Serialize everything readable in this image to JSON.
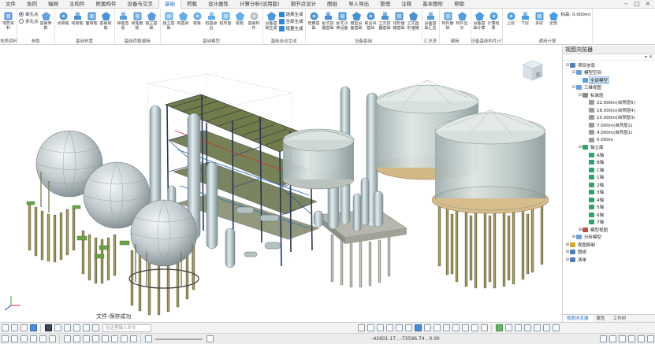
{
  "menu": {
    "tabs": [
      "文件",
      "协同",
      "轴网",
      "主构件",
      "附属构件",
      "设备与交叉",
      "基础",
      "荷载",
      "设计属性",
      "计算分析(试用版)",
      "钢节点设计",
      "图纸",
      "导入导出",
      "管理",
      "注释",
      "基本图形",
      "帮助"
    ],
    "active_index": 6
  },
  "ribbon": {
    "groups": [
      {
        "label": "地质资料",
        "buttons": [
          {
            "label": "地质资料",
            "icon": "geology-icon",
            "color": "#3a7bd5"
          }
        ]
      },
      {
        "label": "参数",
        "small": [
          {
            "label": "单孔点",
            "type": "radio",
            "on": true
          },
          {
            "label": "多孔点",
            "type": "radio",
            "on": false
          }
        ],
        "buttons": [
          {
            "label": "基础参数",
            "icon": "params-icon",
            "color": "#4a90d9"
          }
        ]
      },
      {
        "label": "基础布置",
        "buttons": [
          {
            "label": "点荷载",
            "icon": "point-load-icon",
            "color": "#2f80c9"
          },
          {
            "label": "线荷载",
            "icon": "line-load-icon",
            "color": "#2f80c9"
          },
          {
            "label": "面荷载",
            "icon": "area-load-icon",
            "color": "#2f80c9"
          },
          {
            "label": "基础荷载",
            "icon": "foundation-load-icon",
            "color": "#2f80c9"
          }
        ]
      },
      {
        "label": "基础荷载编辑",
        "buttons": [
          {
            "label": "荷载查看",
            "icon": "load-view-icon",
            "color": "#3d8ad6"
          },
          {
            "label": "荷载删除",
            "icon": "load-delete-icon",
            "color": "#3d8ad6"
          },
          {
            "label": "独立基础",
            "icon": "isolated-footing-icon",
            "color": "#3d8ad6"
          }
        ]
      },
      {
        "label": "基础模型",
        "buttons": [
          {
            "label": "独立基础",
            "icon": "isolated-footing-icon",
            "color": "#4aa0e0"
          },
          {
            "label": "地基梁",
            "icon": "grade-beam-icon",
            "color": "#4aa0e0"
          },
          {
            "label": "筏板",
            "icon": "raft-icon",
            "color": "#4aa0e0"
          },
          {
            "label": "桩基承台",
            "icon": "pile-cap-icon",
            "color": "#4aa0e0"
          },
          {
            "label": "桩布置",
            "icon": "pile-icon",
            "color": "#4aa0e0"
          },
          {
            "label": "桩帽",
            "icon": "pile-hat-icon",
            "color": "#4aa0e0"
          },
          {
            "label": "基础构件",
            "icon": "member-icon",
            "color": "#aab4bf"
          }
        ]
      },
      {
        "label": "基础自动生成",
        "buttons": [
          {
            "label": "设备基础生成参数",
            "icon": "gen-params-icon",
            "color": "#2f86d2"
          }
        ],
        "small": [
          {
            "label": "选择生成",
            "type": "icon",
            "color": "#2f86d2"
          },
          {
            "label": "全部生成",
            "type": "icon",
            "color": "#2f86d2"
          },
          {
            "label": "增量生成",
            "type": "icon",
            "color": "#2f86d2"
          }
        ]
      },
      {
        "label": "设备基础",
        "buttons": [
          {
            "label": "管廊基础",
            "icon": "pipe-rack-icon",
            "color": "#2d7cc8"
          },
          {
            "label": "卧式容器基础",
            "icon": "horizontal-vessel-icon",
            "color": "#2d7cc8"
          },
          {
            "label": "卧式冷换设备基础",
            "icon": "exchanger-icon",
            "color": "#2d7cc8"
          },
          {
            "label": "模型设备基础",
            "icon": "model-equip-icon",
            "color": "#2d7cc8"
          },
          {
            "label": "联合块基础",
            "icon": "combined-block-icon",
            "color": "#2d7cc8"
          },
          {
            "label": "立式容器基础",
            "icon": "vertical-vessel-icon",
            "color": "#2d7cc8"
          },
          {
            "label": "球形储罐基础",
            "icon": "sphere-tank-icon",
            "color": "#2d7cc8"
          },
          {
            "label": "立式圆形储罐基础",
            "icon": "cylinder-tank-icon",
            "color": "#2d7cc8"
          }
        ]
      },
      {
        "label": "汇总表",
        "buttons": [
          {
            "label": "设备基础汇总表",
            "icon": "summary-table-icon",
            "color": "#3b8bd4"
          }
        ]
      },
      {
        "label": "编辑",
        "buttons": [
          {
            "label": "构件删除",
            "icon": "member-delete-icon",
            "color": "#3b8bd4"
          },
          {
            "label": "构件显示",
            "icon": "member-show-icon",
            "color": "#3b8bd4"
          }
        ]
      },
      {
        "label": "设备基础构件计算",
        "buttons": [
          {
            "label": "设备基础计算",
            "icon": "calc-run-icon",
            "color": "#2e8bd8"
          },
          {
            "label": "计算结果",
            "icon": "calc-result-icon",
            "color": "#2e8bd8"
          }
        ]
      },
      {
        "label": "通用计算",
        "buttons": [
          {
            "label": "上层",
            "icon": "floor-up-icon",
            "color": "#2e8bd8"
          },
          {
            "label": "下层",
            "icon": "floor-down-icon",
            "color": "#2e8bd8"
          },
          {
            "label": "多层",
            "icon": "multi-floor-icon",
            "color": "#2e8bd8"
          },
          {
            "label": "全部",
            "icon": "all-floors-icon",
            "color": "#2e8bd8"
          }
        ],
        "small": [
          {
            "label": "标高: 0.000m)",
            "type": "text"
          }
        ]
      }
    ]
  },
  "viewport": {
    "status_message": "文件-保存成功",
    "nav_cube_label": "前"
  },
  "browser": {
    "title": "视图浏览器",
    "tree": [
      {
        "depth": 0,
        "label": "项目信息",
        "expanded": true,
        "icon_color": "#4d7fb8"
      },
      {
        "depth": 1,
        "label": "模型空间",
        "expanded": true,
        "icon_color": "#6a9fd8"
      },
      {
        "depth": 2,
        "label": "全部模型",
        "icon_color": "#5aa0e0",
        "selected": true
      },
      {
        "depth": 1,
        "label": "三维视图",
        "expanded": true,
        "icon_color": "#6a9fd8"
      },
      {
        "depth": 2,
        "label": "标准层",
        "expanded": true,
        "icon_color": "#888888"
      },
      {
        "depth": 3,
        "label": "22.000m(自然层5)",
        "icon_color": "#999999"
      },
      {
        "depth": 3,
        "label": "18.000m(自然层4)",
        "icon_color": "#999999"
      },
      {
        "depth": 3,
        "label": "10.000m(自然层3)",
        "icon_color": "#999999"
      },
      {
        "depth": 3,
        "label": "7.000m(自然层2)",
        "icon_color": "#999999"
      },
      {
        "depth": 3,
        "label": "4.000m(自然层1)",
        "icon_color": "#999999"
      },
      {
        "depth": 3,
        "label": "0.000m",
        "icon_color": "#999999"
      },
      {
        "depth": 2,
        "label": "轴立面",
        "expanded": true,
        "icon_color": "#3a9e6a"
      },
      {
        "depth": 3,
        "label": "A轴",
        "icon_color": "#3a9e6a"
      },
      {
        "depth": 3,
        "label": "B轴",
        "icon_color": "#3a9e6a"
      },
      {
        "depth": 3,
        "label": "C轴",
        "icon_color": "#3a9e6a"
      },
      {
        "depth": 3,
        "label": "1轴",
        "icon_color": "#3a9e6a"
      },
      {
        "depth": 3,
        "label": "2轴",
        "icon_color": "#3a9e6a"
      },
      {
        "depth": 3,
        "label": "3轴",
        "icon_color": "#3a9e6a"
      },
      {
        "depth": 3,
        "label": "4轴",
        "icon_color": "#3a9e6a"
      },
      {
        "depth": 3,
        "label": "5轴",
        "icon_color": "#3a9e6a"
      },
      {
        "depth": 3,
        "label": "6轴",
        "icon_color": "#3a9e6a"
      },
      {
        "depth": 3,
        "label": "7轴",
        "icon_color": "#3a9e6a"
      },
      {
        "depth": 2,
        "label": "模型视图",
        "expanded": false,
        "icon_color": "#c0504d"
      },
      {
        "depth": 1,
        "label": "分析模型",
        "expanded": false,
        "icon_color": "#6a9fd8"
      },
      {
        "depth": 0,
        "label": "视图族制",
        "expanded": false,
        "icon_color": "#d8a23a"
      },
      {
        "depth": 0,
        "label": "图纸",
        "expanded": false,
        "icon_color": "#4d7fb8"
      },
      {
        "depth": 0,
        "label": "清单",
        "expanded": false,
        "icon_color": "#4d7fb8"
      }
    ],
    "tabs": [
      "视图浏览器",
      "属性",
      "工作树"
    ],
    "active_tab": 0
  },
  "cmdbar": {
    "placeholder": "在这里输入命令"
  },
  "statusbar": {
    "coords": "-42601.17 , -73596.74 , 0.00"
  }
}
